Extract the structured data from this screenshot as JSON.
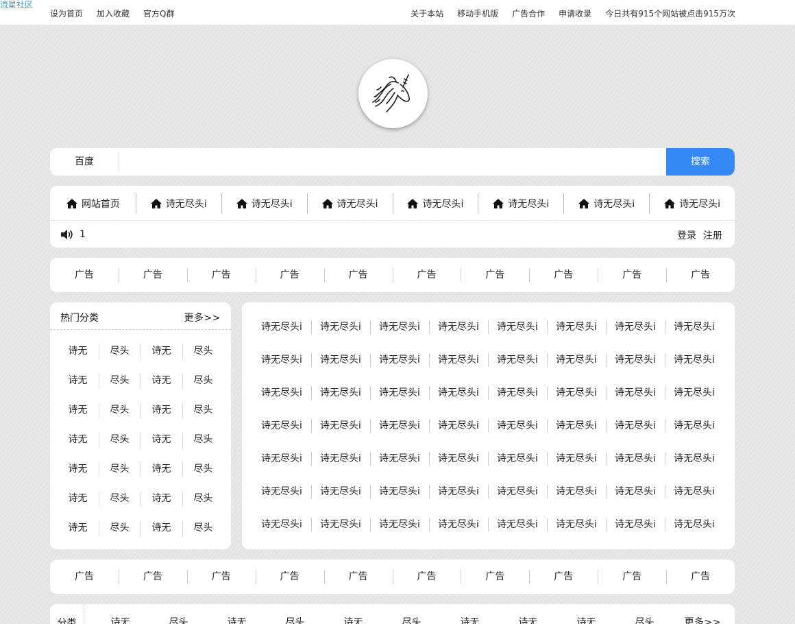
{
  "header": {
    "brand": "流星社区",
    "left_links": [
      "设为首页",
      "加入收藏",
      "官方Q群"
    ],
    "right_links": [
      "关于本站",
      "移动手机版",
      "广告合作",
      "申请收录",
      "今日共有915个网站被点击915万次"
    ]
  },
  "logo": {
    "icon": "unicorn-icon"
  },
  "search": {
    "engine": "百度",
    "placeholder": "",
    "button_label": "搜索",
    "accent_color": "#3589f5"
  },
  "nav": {
    "items": [
      "网站首页",
      "诗无尽头i",
      "诗无尽头i",
      "诗无尽头i",
      "诗无尽头i",
      "诗无尽头i",
      "诗无尽头i",
      "诗无尽头i"
    ],
    "icon": "home-icon",
    "notice_icon": "speaker-icon",
    "notice_text": "1",
    "login_label": "登录",
    "register_label": "注册"
  },
  "ads_top": [
    "广告",
    "广告",
    "广告",
    "广告",
    "广告",
    "广告",
    "广告",
    "广告",
    "广告",
    "广告"
  ],
  "hot_categories": {
    "title": "热门分类",
    "more": "更多>>",
    "items": [
      "诗无",
      "尽头",
      "诗无",
      "尽头",
      "诗无",
      "尽头",
      "诗无",
      "尽头",
      "诗无",
      "尽头",
      "诗无",
      "尽头",
      "诗无",
      "尽头",
      "诗无",
      "尽头",
      "诗无",
      "尽头",
      "诗无",
      "尽头",
      "诗无",
      "尽头",
      "诗无",
      "尽头",
      "诗无",
      "尽头",
      "诗无",
      "尽头"
    ]
  },
  "site_links": [
    "诗无尽头i",
    "诗无尽头i",
    "诗无尽头i",
    "诗无尽头i",
    "诗无尽头i",
    "诗无尽头i",
    "诗无尽头i",
    "诗无尽头i",
    "诗无尽头i",
    "诗无尽头i",
    "诗无尽头i",
    "诗无尽头i",
    "诗无尽头i",
    "诗无尽头i",
    "诗无尽头i",
    "诗无尽头i",
    "诗无尽头i",
    "诗无尽头i",
    "诗无尽头i",
    "诗无尽头i",
    "诗无尽头i",
    "诗无尽头i",
    "诗无尽头i",
    "诗无尽头i",
    "诗无尽头i",
    "诗无尽头i",
    "诗无尽头i",
    "诗无尽头i",
    "诗无尽头i",
    "诗无尽头i",
    "诗无尽头i",
    "诗无尽头i",
    "诗无尽头i",
    "诗无尽头i",
    "诗无尽头i",
    "诗无尽头i",
    "诗无尽头i",
    "诗无尽头i",
    "诗无尽头i",
    "诗无尽头i",
    "诗无尽头i",
    "诗无尽头i",
    "诗无尽头i",
    "诗无尽头i",
    "诗无尽头i",
    "诗无尽头i",
    "诗无尽头i",
    "诗无尽头i",
    "诗无尽头i",
    "诗无尽头i",
    "诗无尽头i",
    "诗无尽头i",
    "诗无尽头i",
    "诗无尽头i",
    "诗无尽头i",
    "诗无尽头i"
  ],
  "ads_bottom": [
    "广告",
    "广告",
    "广告",
    "广告",
    "广告",
    "广告",
    "广告",
    "广告",
    "广告",
    "广告"
  ],
  "category_bar": {
    "label": "分类",
    "items": [
      "诗无",
      "尽头",
      "诗无",
      "尽头",
      "诗无",
      "尽头",
      "诗无",
      "诗无",
      "诗无",
      "尽头"
    ],
    "more": "更多>>"
  }
}
